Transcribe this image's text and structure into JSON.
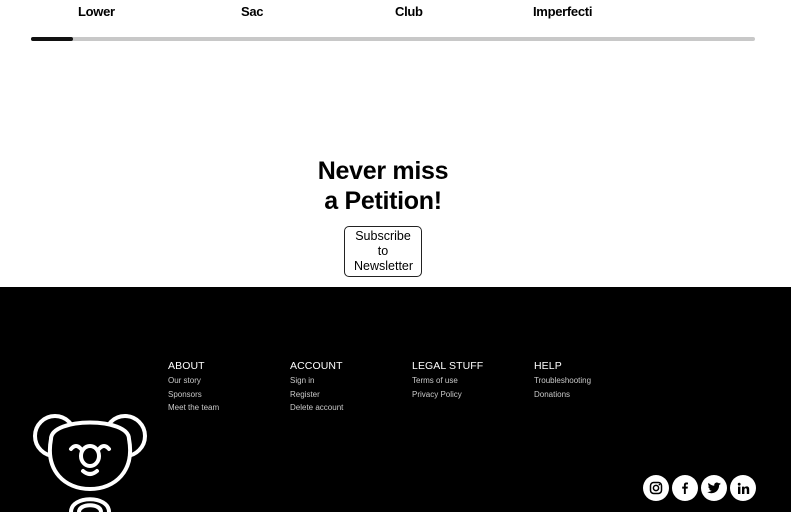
{
  "carousel": {
    "items": [
      "Lower",
      "Sac",
      "Club",
      "Imperfecti"
    ],
    "progress_fraction": 0.058
  },
  "newsletter": {
    "title_line1": "Never miss",
    "title_line2": "a Petition!",
    "subscribe_line1": "Subscribe to",
    "subscribe_line2": "Newsletter"
  },
  "footer": {
    "columns": [
      {
        "heading": "ABOUT",
        "links": [
          "Our story",
          "Sponsors",
          "Meet the team"
        ]
      },
      {
        "heading": "ACCOUNT",
        "links": [
          "Sign in",
          "Register",
          "Delete account"
        ]
      },
      {
        "heading": "LEGAL STUFF",
        "links": [
          "Terms of use",
          "Privacy Policy"
        ]
      },
      {
        "heading": "HELP",
        "links": [
          "Troubleshooting",
          "Donations"
        ]
      }
    ],
    "socials": [
      "instagram-icon",
      "facebook-icon",
      "twitter-icon",
      "linkedin-icon"
    ],
    "logo": "koala-logo"
  }
}
